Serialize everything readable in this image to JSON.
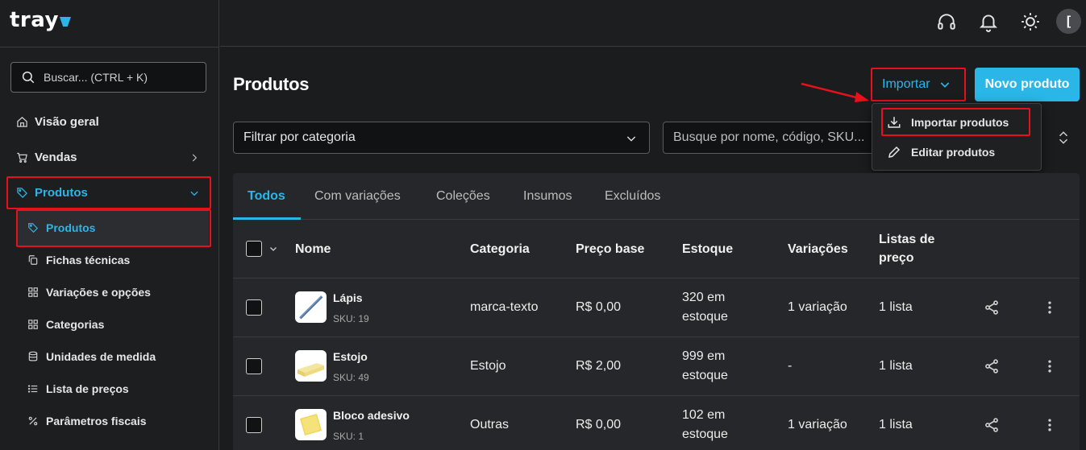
{
  "brand": {
    "logo_text": "tray",
    "accent": "#2bb6e8",
    "highlight": "#e8101a"
  },
  "sidebar": {
    "search_placeholder": "Buscar... (CTRL + K)",
    "items": [
      {
        "label": "Visão geral",
        "icon": "home-icon"
      },
      {
        "label": "Vendas",
        "icon": "cart-icon"
      },
      {
        "label": "Produtos",
        "icon": "tag-icon",
        "active": true
      }
    ],
    "sub_items": [
      {
        "label": "Produtos",
        "icon": "tag-icon",
        "active": true
      },
      {
        "label": "Fichas técnicas",
        "icon": "copy-icon"
      },
      {
        "label": "Variações e opções",
        "icon": "grid-icon"
      },
      {
        "label": "Categorias",
        "icon": "grid-icon"
      },
      {
        "label": "Unidades de medida",
        "icon": "database-icon"
      },
      {
        "label": "Lista de preços",
        "icon": "list-icon"
      },
      {
        "label": "Parâmetros fiscais",
        "icon": "percent-icon"
      }
    ]
  },
  "topbar": {
    "avatar_initial": "["
  },
  "main": {
    "title": "Produtos",
    "import_label": "Importar",
    "new_product_label": "Novo produto",
    "category_filter": "Filtrar por categoria",
    "search_placeholder": "Busque por nome, código, SKU...",
    "dropdown": [
      {
        "label": "Importar produtos",
        "icon": "download-icon"
      },
      {
        "label": "Editar produtos",
        "icon": "pencil-icon"
      }
    ],
    "tabs": [
      "Todos",
      "Com variações",
      "Coleções",
      "Insumos",
      "Excluídos"
    ],
    "columns": [
      "Nome",
      "Categoria",
      "Preço base",
      "Estoque",
      "Variações",
      "Listas de preço"
    ],
    "rows": [
      {
        "name": "Lápis",
        "sku": "SKU: 19",
        "category": "marca-texto",
        "price": "R$ 0,00",
        "stock": "320 em estoque",
        "variations": "1 variação",
        "price_lists": "1 lista"
      },
      {
        "name": "Estojo",
        "sku": "SKU: 49",
        "category": "Estojo",
        "price": "R$ 2,00",
        "stock": "999 em estoque",
        "variations": "-",
        "price_lists": "1 lista"
      },
      {
        "name": "Bloco adesivo",
        "sku": "SKU: 1",
        "category": "Outras",
        "price": "R$ 0,00",
        "stock": "102 em estoque",
        "variations": "1 variação",
        "price_lists": "1 lista"
      }
    ]
  }
}
